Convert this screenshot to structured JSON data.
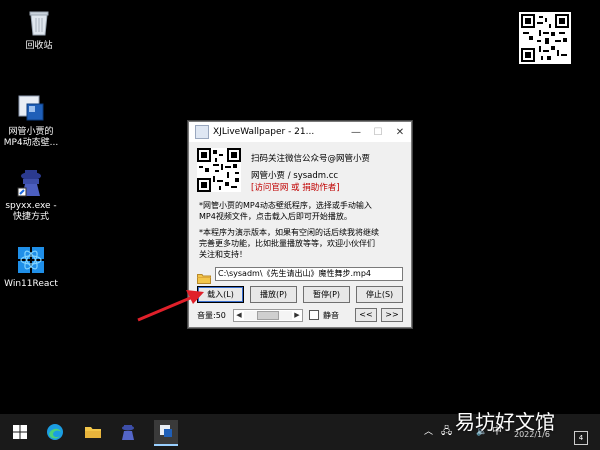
{
  "desktop": {
    "icons": [
      {
        "label": "回收站"
      },
      {
        "label": "网管小贾的\nMP4动态壁..."
      },
      {
        "label": "spyxx.exe -\n快捷方式"
      },
      {
        "label": "Win11React"
      }
    ]
  },
  "window": {
    "title": "XJLiveWallpaper - 21...",
    "minimize": "—",
    "maximize": "☐",
    "close": "✕",
    "info_line1": "扫码关注微信公众号@网管小贾",
    "info_line2": "网管小贾 / sysadm.cc",
    "info_line3": "[访问官网 或 捐助作者]",
    "desc1": "*网管小贾的MP4动态壁纸程序，选择或手动输入\nMP4视频文件，点击载入后即可开始播放。",
    "desc2": "*本程序为演示版本，如果有空闲的话后续我将继续\n完善更多功能，比如批量播放等等，欢迎小伙伴们\n关注和支持！",
    "path": "C:\\sysadm\\《先生请出山》魔性舞步.mp4",
    "buttons": {
      "load": "载入(L)",
      "play": "播放(P)",
      "pause": "暂停(P)",
      "stop": "停止(S)"
    },
    "volume": "音量:50",
    "volume_value": 50,
    "mute": "静音",
    "prev": "<<",
    "next": ">>"
  },
  "taskbar": {
    "tray_lang": "中",
    "time": "1:51",
    "date": "2022/1/6",
    "notifications": "4"
  },
  "watermark": "易坊好文馆",
  "colors": {
    "desktop_bg": "#000000",
    "link_red": "#c00000",
    "arrow_red": "#e0202a",
    "taskbar_bg": "#1a1a1a"
  }
}
